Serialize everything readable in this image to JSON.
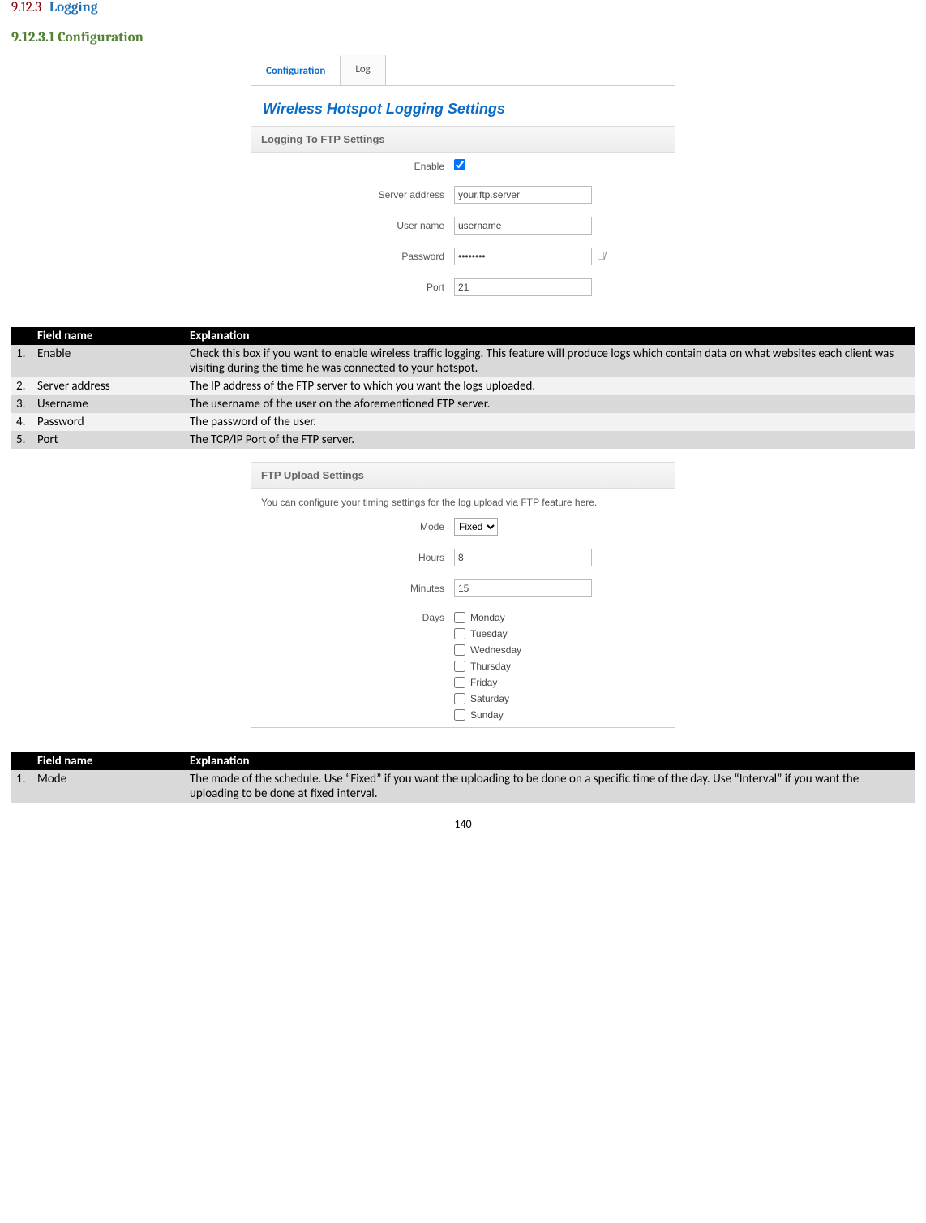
{
  "headings": {
    "h3_num": "9.12.3",
    "h3_title": "Logging",
    "h4": "9.12.3.1 Configuration"
  },
  "panel1": {
    "tab_config": "Configuration",
    "tab_log": "Log",
    "title": "Wireless Hotspot Logging Settings",
    "section": "Logging To FTP Settings",
    "labels": {
      "enable": "Enable",
      "server": "Server address",
      "user": "User name",
      "password": "Password",
      "port": "Port"
    },
    "values": {
      "server": "your.ftp.server",
      "user": "username",
      "password": "••••••••",
      "port": "21"
    }
  },
  "table1": {
    "hdr_field": "Field name",
    "hdr_exp": "Explanation",
    "rows": [
      {
        "n": "1.",
        "f": "Enable",
        "e": "Check this box if you want to enable wireless traffic logging. This feature will produce logs which contain data on what websites each client was visiting during the time he was connected to your hotspot."
      },
      {
        "n": "2.",
        "f": "Server address",
        "e": "The IP address of the FTP server to which you want the logs uploaded."
      },
      {
        "n": "3.",
        "f": "Username",
        "e": "The username of the user on the aforementioned FTP server."
      },
      {
        "n": "4.",
        "f": "Password",
        "e": "The password of the user."
      },
      {
        "n": "5.",
        "f": "Port",
        "e": "The TCP/IP Port of the FTP server."
      }
    ]
  },
  "panel2": {
    "section": "FTP Upload Settings",
    "desc": "You can configure your timing settings for the log upload via FTP feature here.",
    "labels": {
      "mode": "Mode",
      "hours": "Hours",
      "minutes": "Minutes",
      "days": "Days"
    },
    "values": {
      "mode": "Fixed",
      "hours": "8",
      "minutes": "15"
    },
    "days": [
      "Monday",
      "Tuesday",
      "Wednesday",
      "Thursday",
      "Friday",
      "Saturday",
      "Sunday"
    ]
  },
  "table2": {
    "hdr_field": "Field name",
    "hdr_exp": "Explanation",
    "rows": [
      {
        "n": "1.",
        "f": "Mode",
        "e": "The mode of the schedule. Use “Fixed” if you want the uploading to be done on a specific time of the day. Use “Interval” if you want the uploading to be done at fixed interval."
      }
    ]
  },
  "page_number": "140"
}
